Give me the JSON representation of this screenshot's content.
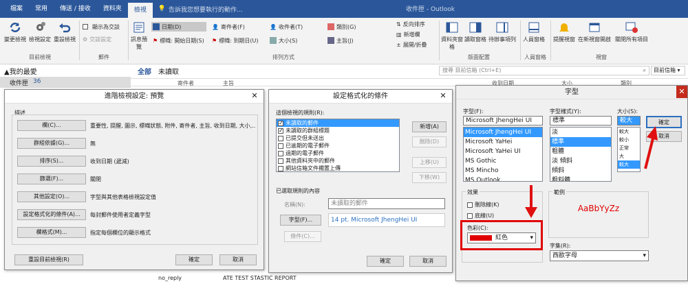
{
  "ribbon_tabs": [
    "檔案",
    "常用",
    "傳送 / 接收",
    "資料夾",
    "檢視"
  ],
  "tell_me": "告訴我您想要執行的動作...",
  "title_fragment": "收件匣 - Outlook",
  "ribbon": {
    "change_view": "變更檢視",
    "view_settings": "檢視設定",
    "reset_view": "重設檢視",
    "show_as_conversation": "顯示為交談",
    "conversation_settings": "交談設定",
    "group_current_view": "目前檢視",
    "group_messages": "郵件",
    "message_preview": "訊息預覽",
    "arr_date": "日期(D)",
    "arr_from": "寄件者(F)",
    "arr_to": "收件者(T)",
    "arr_categories": "類別(G)",
    "arr_flag_start": "標幟: 開始日期(S)",
    "arr_flag_due": "標幟: 到期日(U)",
    "arr_size": "大小(S)",
    "arr_subject": "主旨(J)",
    "reverse_sort": "反向排序",
    "add_columns": "新增欄",
    "expand_collapse": "展開/折疊",
    "group_arrangement": "排列方式",
    "folder_pane": "資料夾窗格",
    "reading_pane": "讀取窗格",
    "todo_bar": "待辦事項列",
    "group_layout": "版面配置",
    "people_pane": "人員窗格",
    "group_people": "人員窗格",
    "reminders": "提醒視窗",
    "open_new_window": "在新視窗開啟",
    "close_all": "關閉所有項目",
    "group_window": "視窗"
  },
  "folders": {
    "favorites": "▲我的最愛",
    "inbox": "收件匣",
    "inbox_count": "36"
  },
  "mail": {
    "all": "全部",
    "unread": "未讀取",
    "search_placeholder": "搜尋 目前信箱 (Ctrl+E)",
    "mailbox_scope": "目前信箱",
    "col_from": "寄件者",
    "col_subject": "主旨",
    "col_received": "收到日期",
    "col_size": "大小",
    "col_category": "類別",
    "row_from": "no_reply",
    "row_subject": "ATE TEST STASTIC REPORT"
  },
  "adv": {
    "title": "進階檢視設定: 預覽",
    "section": "描述",
    "rows": [
      {
        "btn": "欄(C)...",
        "desc": "重要性, 提醒, 圖示, 標幟狀態, 附件, 寄件者, 主旨, 收到日期, 大小,..."
      },
      {
        "btn": "群組依據(G)...",
        "desc": "無"
      },
      {
        "btn": "排序(S)...",
        "desc": "收到日期 (遞減)"
      },
      {
        "btn": "篩選(F)...",
        "desc": "關閉"
      },
      {
        "btn": "其他設定(O)...",
        "desc": "字型與其他表格檢視設定值"
      },
      {
        "btn": "設定格式化的條件(A)...",
        "desc": "每封郵件使用者定義字型"
      },
      {
        "btn": "欄格式(M)...",
        "desc": "指定每個欄位的顯示格式"
      }
    ],
    "reset": "重設目前檢視(R)",
    "ok": "確定",
    "cancel": "取消"
  },
  "cond": {
    "title": "設定格式化的條件",
    "rules_label": "這個檢視的規則(R):",
    "rules": [
      {
        "text": "未讀取的郵件",
        "checked": true,
        "hl": true
      },
      {
        "text": "未讀取的群組標題",
        "checked": true,
        "hl": false
      },
      {
        "text": "已提交但未送出",
        "checked": false,
        "hl": false
      },
      {
        "text": "已逾期的電子郵件",
        "checked": false,
        "hl": false
      },
      {
        "text": "過期的電子郵件",
        "checked": false,
        "hl": false
      },
      {
        "text": "其他資料夾中的郵件",
        "checked": false,
        "hl": false
      },
      {
        "text": "網站信箱文件擱置上傳",
        "checked": false,
        "hl": false
      }
    ],
    "add": "新增(A)",
    "delete": "刪除(D)",
    "up": "上移(U)",
    "down": "下移(W)",
    "props": "已選取規則的內容",
    "name_label": "名稱(N):",
    "name_value": "未讀取的郵件",
    "font_btn": "字型(F)...",
    "font_desc": "14 pt. Microsoft JhengHei UI",
    "condition_btn": "條件(C)...",
    "ok": "確定",
    "cancel": "取消"
  },
  "font": {
    "title": "字型",
    "font_label": "字型(F):",
    "font_value": "Microsoft JhengHei UI",
    "fonts": [
      "Microsoft JhengHei UI",
      "Microsoft YaHei",
      "Microsoft YaHei UI",
      "MS Gothic",
      "MS Mincho",
      "MS Outlook"
    ],
    "style_label": "字型樣式(Y):",
    "style_value": "標準",
    "styles": [
      "淡",
      "標準",
      "粗體",
      "淡 傾斜",
      "傾斜",
      "粗斜體"
    ],
    "size_label": "大小(S):",
    "size_value": "較大",
    "sizes": [
      "較大",
      "較小",
      "正常",
      "大",
      "較大"
    ],
    "ok": "確定",
    "cancel": "取消",
    "effects": "效果",
    "strike": "刪除線(K)",
    "underline": "底線(U)",
    "color_label": "色彩(C):",
    "color_value": "紅色",
    "color_hex": "#e00000",
    "sample_label": "範例",
    "sample_text": "AaBbYyZz",
    "script_label": "字集(R):",
    "script_value": "西歐字母"
  }
}
